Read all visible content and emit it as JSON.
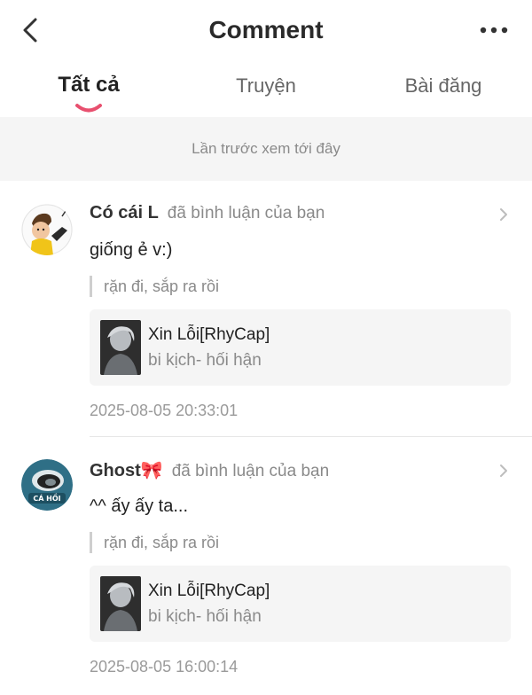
{
  "header": {
    "title": "Comment"
  },
  "tabs": [
    {
      "label": "Tất cả",
      "active": true
    },
    {
      "label": "Truyện",
      "active": false
    },
    {
      "label": "Bài đăng",
      "active": false
    }
  ],
  "notice": "Lần trước xem tới đây",
  "comments": [
    {
      "username": "Có cái L",
      "action": "đã bình luận của bạn",
      "text": "giống ẻ v:)",
      "quote": "rặn đi, sắp ra rồi",
      "card": {
        "title": "Xin Lỗi[RhyCap]",
        "subtitle": "bi kịch- hối hận"
      },
      "timestamp": "2025-08-05 20:33:01"
    },
    {
      "username": "Ghost🎀",
      "action": "đã bình luận của bạn",
      "text": "^^ ấy ấy ta...",
      "quote": "rặn đi, sắp ra rồi",
      "card": {
        "title": "Xin Lỗi[RhyCap]",
        "subtitle": "bi kịch- hối hận"
      },
      "timestamp": "2025-08-05 16:00:14"
    }
  ],
  "colors": {
    "accent": "#e8506f",
    "notice_bg": "#f5f5f5",
    "muted": "#8a8a8a"
  }
}
